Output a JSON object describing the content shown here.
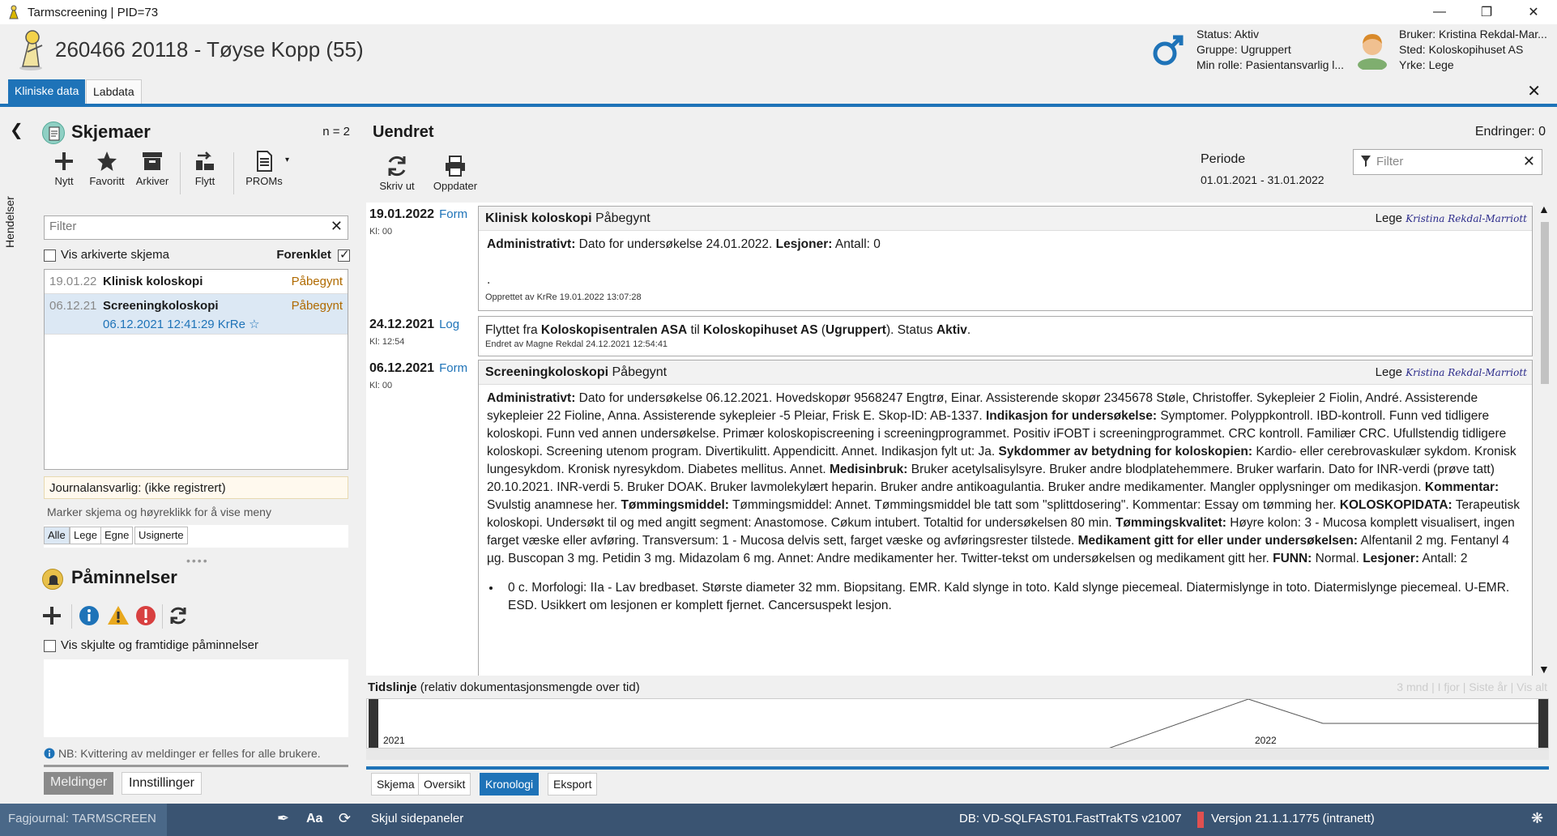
{
  "window": {
    "title": "Tarmscreening | PID=73"
  },
  "patient": {
    "header": "260466 20118 - Tøyse Kopp (55)"
  },
  "status_block": {
    "line1": "Status: Aktiv",
    "line2": "Gruppe: Ugruppert",
    "line3": "Min rolle: Pasientansvarlig l..."
  },
  "user_block": {
    "line1": "Bruker: Kristina Rekdal-Mar...",
    "line2": "Sted: Koloskopihuset AS",
    "line3": "Yrke: Lege"
  },
  "top_tabs": [
    {
      "label": "Kliniske data"
    },
    {
      "label": "Labdata"
    }
  ],
  "rail": {
    "label": "Hendelser"
  },
  "forms": {
    "title": "Skjemaer",
    "count": "n = 2",
    "tools": [
      "Nytt",
      "Favoritt",
      "Arkiver",
      "Flytt",
      "PROMs"
    ],
    "filter_placeholder": "Filter",
    "show_archived": "Vis arkiverte skjema",
    "simplified": "Forenklet",
    "rows": [
      {
        "date": "19.01.22",
        "name": "Klinisk koloskopi",
        "status": "Påbegynt"
      },
      {
        "date": "06.12.21",
        "name": "Screeningkoloskopi",
        "status": "Påbegynt",
        "sub": "06.12.2021 12:41:29 KrRe ☆"
      }
    ],
    "journal": "Journalansvarlig: (ikke registrert)",
    "hint": "Marker skjema og høyreklikk for å vise meny",
    "mini_tabs": [
      "Alle",
      "Lege",
      "Egne",
      "Usignerte"
    ]
  },
  "reminders": {
    "title": "Påminnelser",
    "show_hidden": "Vis skjulte og framtidige påminnelser",
    "note": "NB: Kvittering av meldinger er felles for alle brukere.",
    "tabs": [
      "Meldinger",
      "Innstillinger"
    ]
  },
  "main": {
    "heading": "Uendret",
    "changes": "Endringer: 0",
    "tools": [
      "Skriv ut",
      "Oppdater"
    ],
    "periode_label": "Periode",
    "periode_value": "01.01.2021 - 31.01.2022",
    "filter_placeholder": "Filter"
  },
  "entries": [
    {
      "date": "19.01.2022",
      "type": "Form",
      "kl": "Kl: 00",
      "title": "Klinisk koloskopi",
      "status": "Påbegynt",
      "role": "Lege",
      "signature": "Kristina Rekdal-Marriott",
      "body": [
        {
          "b": "Administrativt:",
          "t": " Dato for undersøkelse 24.01.2022. "
        },
        {
          "b": "Lesjoner:",
          "t": " Antall: 0"
        }
      ],
      "dot": ".",
      "footer": "Opprettet av KrRe 19.01.2022 13:07:28"
    },
    {
      "date": "24.12.2021",
      "type": "Log",
      "kl": "Kl: 12:54",
      "body": [
        {
          "b": "",
          "t": "Flyttet fra "
        },
        {
          "b": "Koloskopisentralen ASA",
          "t": " til "
        },
        {
          "b": "Koloskopihuset AS",
          "t": " ("
        },
        {
          "b": "Ugruppert",
          "t": "). Status "
        },
        {
          "b": "Aktiv",
          "t": "."
        }
      ],
      "footer": "Endret av Magne Rekdal 24.12.2021 12:54:41"
    },
    {
      "date": "06.12.2021",
      "type": "Form",
      "kl": "Kl: 00",
      "title": "Screeningkoloskopi",
      "status": "Påbegynt",
      "role": "Lege",
      "signature": "Kristina Rekdal-Marriott",
      "body": [
        {
          "b": "Administrativt:",
          "t": " Dato for undersøkelse 06.12.2021. Hovedskopør 9568247 Engtrø, Einar. Assisterende skopør 2345678 Støle, Christoffer. Sykepleier 2 Fiolin, André. Assisterende sykepleier 22 Fioline, Anna. Assisterende sykepleier -5 Pleiar, Frisk E. Skop-ID: AB-1337. "
        },
        {
          "b": "Indikasjon for undersøkelse:",
          "t": " Symptomer. Polyppkontroll. IBD-kontroll. Funn ved tidligere koloskopi. Funn ved annen undersøkelse. Primær koloskopiscreening i screeningprogrammet. Positiv iFOBT i screeningprogrammet. CRC kontroll. Familiær CRC. Ufullstendig tidligere koloskopi. Screening utenom program. Divertikulitt. Appendicitt. Annet. Indikasjon fylt ut: Ja. "
        },
        {
          "b": "Sykdommer av betydning for koloskopien:",
          "t": " Kardio- eller cerebrovaskulær sykdom. Kronisk lungesykdom. Kronisk nyresykdom. Diabetes mellitus. Annet. "
        },
        {
          "b": "Medisinbruk:",
          "t": " Bruker acetylsalisylsyre. Bruker andre blodplatehemmere. Bruker warfarin. Dato for INR-verdi (prøve tatt) 20.10.2021. INR-verdi 5. Bruker DOAK. Bruker lavmolekylært heparin. Bruker andre antikoagulantia. Bruker andre medikamenter. Mangler opplysninger om medikasjon. "
        },
        {
          "b": "Kommentar:",
          "t": " Svulstig anamnese her. "
        },
        {
          "b": "Tømmingsmiddel:",
          "t": " Tømmingsmiddel: Annet. Tømmingsmiddel ble tatt som \"splittdosering\". Kommentar: Essay om tømming her. "
        },
        {
          "b": "KOLOSKOPIDATA:",
          "t": " Terapeutisk koloskopi. Undersøkt til og med angitt segment: Anastomose. Cøkum intubert. Totaltid for undersøkelsen 80 min. "
        },
        {
          "b": "Tømmingskvalitet:",
          "t": " Høyre kolon: 3 - Mucosa komplett visualisert, ingen farget væske eller avføring. Transversum: 1 - Mucosa delvis sett, farget væske og avføringsrester tilstede. "
        },
        {
          "b": "Medikament gitt for eller under undersøkelsen:",
          "t": " Alfentanil 2 mg. Fentanyl 4 µg. Buscopan 3 mg. Petidin 3 mg. Midazolam 6 mg. Annet: Andre medikamenter her. Twitter-tekst om undersøkelsen og medikament gitt her. "
        },
        {
          "b": "FUNN:",
          "t": " Normal. "
        },
        {
          "b": "Lesjoner:",
          "t": " Antall: 2"
        }
      ],
      "bullet": "0 c. Morfologi: IIa - Lav bredbaset. Største diameter 32 mm. Biopsitang. EMR. Kald slynge in toto. Kald slynge piecemeal. Diatermislynge in toto. Diatermislynge piecemeal. U-EMR. ESD. Usikkert om lesjonen er komplett fjernet. Cancersuspekt lesjon."
    }
  ],
  "timeline": {
    "title": "Tidslinje",
    "subtitle": "(relativ dokumentasjonsmengde over tid)",
    "ranges": "3 mnd  |  I fjor  |  Siste år  |  Vis alt",
    "labels": [
      "2021",
      "2022"
    ]
  },
  "main_tabs": [
    "Skjema",
    "Oversikt",
    "Kronologi",
    "Eksport"
  ],
  "statusbar": {
    "fagjournal": "Fagjournal: TARMSCREEN",
    "hide_panels": "Skjul sidepaneler",
    "db": "DB: VD-SQLFAST01.FastTrakTS v21007",
    "version": "Versjon 21.1.1.1775 (intranett)"
  },
  "colors": {
    "accent": "#1e73b8",
    "status_bar": "#3a5472",
    "pending": "#b06a00"
  }
}
